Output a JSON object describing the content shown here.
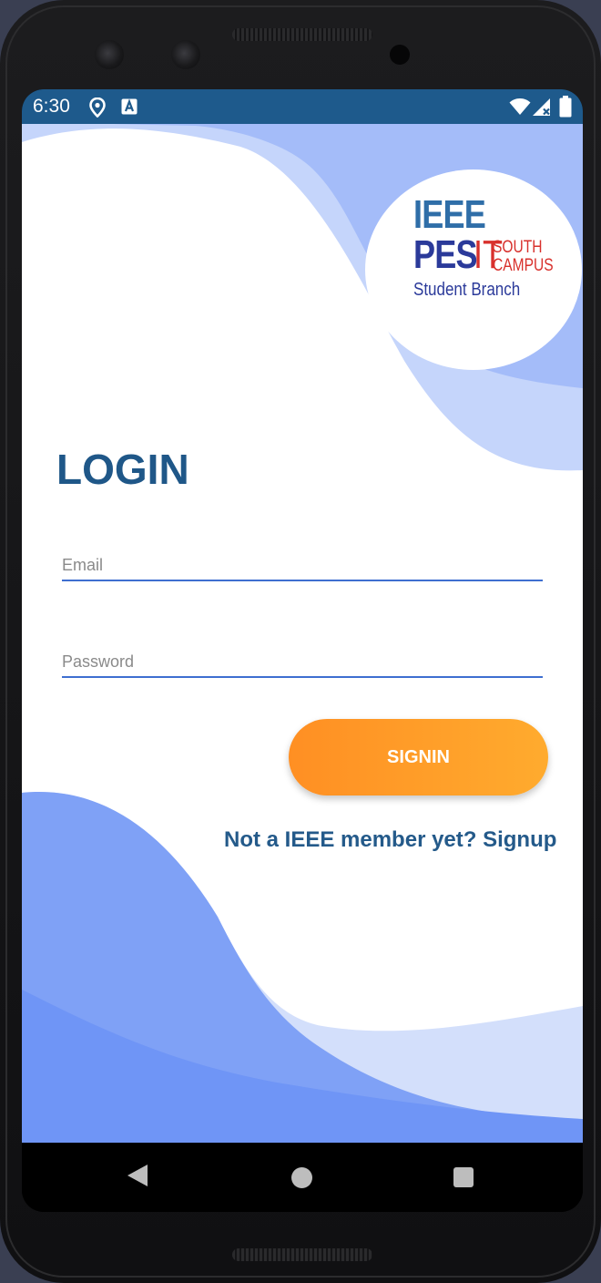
{
  "status_bar": {
    "time": "6:30",
    "icons_left": [
      "location-icon",
      "accessibility-a-icon"
    ],
    "icons_right": [
      "wifi-icon",
      "cell-signal-icon",
      "battery-icon"
    ],
    "background_color": "#1e5a8c"
  },
  "logo": {
    "line1": "IEEE",
    "pes": "PES",
    "it": "IT",
    "south": "SOUTH",
    "campus": "CAMPUS",
    "branch": "Student Branch"
  },
  "login": {
    "title": "LOGIN",
    "email_placeholder": "Email",
    "email_value": "",
    "password_placeholder": "Password",
    "password_value": "",
    "signin_label": "SIGNIN",
    "signup_link": "Not a IEEE member yet? Signup"
  },
  "nav_bar": {
    "buttons": [
      "back-icon",
      "home-icon",
      "recents-icon"
    ]
  },
  "colors": {
    "accent_orange": "#ff9a28",
    "title_blue": "#1f5788",
    "wave_blue": "#7b9ef5",
    "underline_blue": "#3e6fd0"
  }
}
